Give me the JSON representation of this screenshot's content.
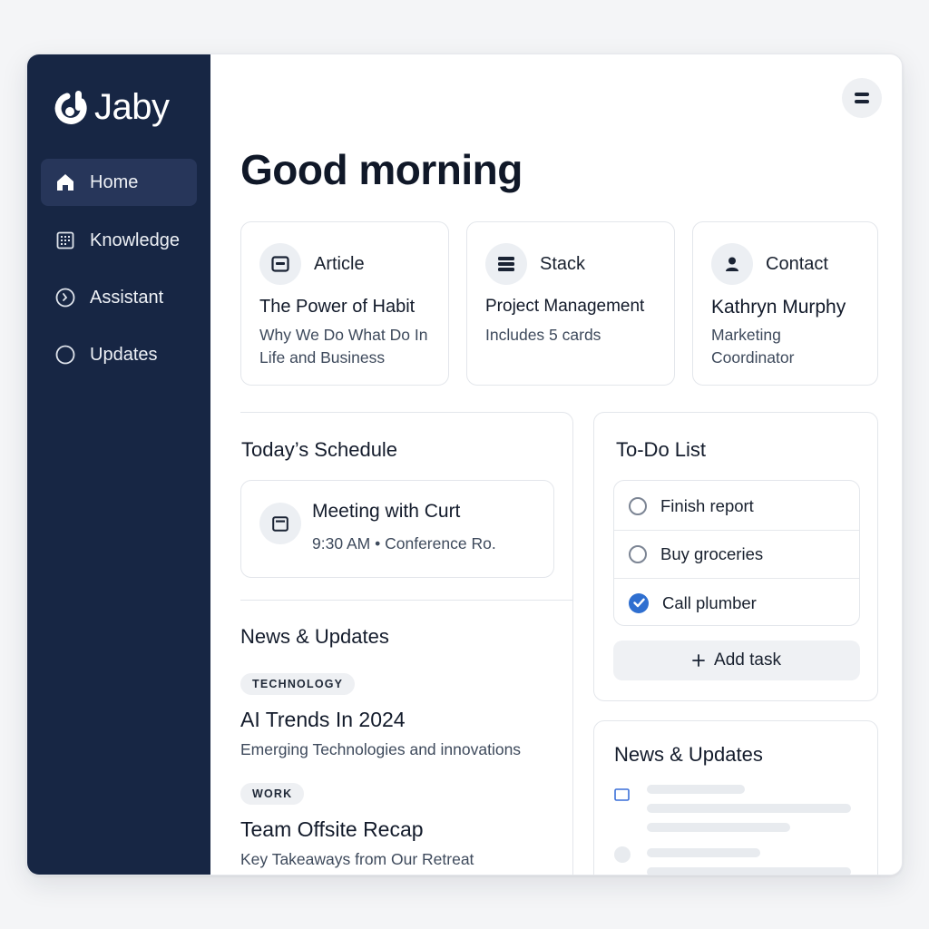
{
  "app": {
    "name": "Jaby"
  },
  "sidebar": {
    "items": [
      {
        "label": "Home",
        "icon": "home-icon",
        "active": true
      },
      {
        "label": "Knowledge",
        "icon": "grid-book-icon"
      },
      {
        "label": "Assistant",
        "icon": "clock-icon"
      },
      {
        "label": "Updates",
        "icon": "circle-icon"
      }
    ]
  },
  "header": {
    "menu_icon": "menu-icon"
  },
  "greeting": "Good morning",
  "quick_cards": [
    {
      "type": "Article",
      "icon": "article-icon",
      "title": "The Power of Habit",
      "subtitle": "Why We Do What Do In Life and Business"
    },
    {
      "type": "Stack",
      "icon": "stack-icon",
      "title": "Project Management",
      "subtitle": "Includes 5 cards"
    },
    {
      "type": "Contact",
      "icon": "person-icon",
      "title": "Kathryn Murphy",
      "subtitle": "Marketing Coordinator"
    }
  ],
  "schedule": {
    "title": "Today’s Schedule",
    "event": {
      "title": "Meeting with Curt",
      "time": "9:30 AM",
      "separator": "•",
      "location": "Conference Ro."
    }
  },
  "news": {
    "title": "News & Updates",
    "items": [
      {
        "tag": "TECHNOLOGY",
        "title": "AI Trends In 2024",
        "subtitle": "Emerging Technologies and innovations"
      },
      {
        "tag": "WORK",
        "title": "Team Offsite Recap",
        "subtitle": "Key Takeaways from Our Retreat"
      }
    ]
  },
  "todo": {
    "title": "To-Do List",
    "items": [
      {
        "label": "Finish report",
        "done": false
      },
      {
        "label": "Buy groceries",
        "done": false
      },
      {
        "label": "Call plumber",
        "done": true
      }
    ],
    "add_label": "Add task",
    "add_icon": "plus-icon"
  },
  "news_side": {
    "title": "News & Updates"
  },
  "colors": {
    "sidebar": "#172644",
    "accent": "#2f6fd0",
    "active_nav": "#27365a"
  }
}
